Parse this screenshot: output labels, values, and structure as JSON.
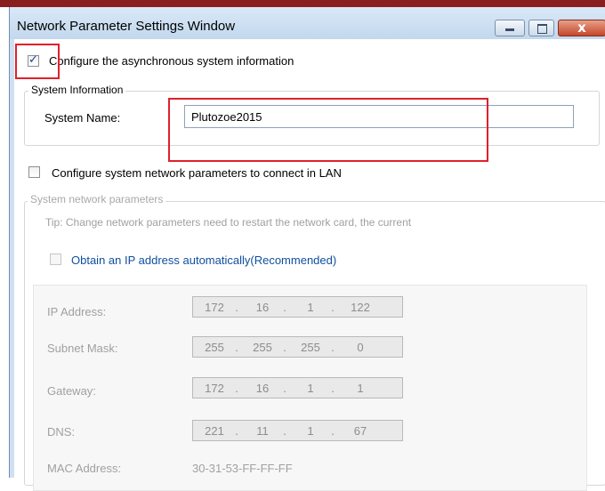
{
  "window": {
    "title": "Network Parameter Settings Window",
    "close_glyph": "x"
  },
  "async_config": {
    "checked": true,
    "label": "Configure the asynchronous system information"
  },
  "system_info": {
    "legend": "System Information",
    "name_label": "System Name:",
    "name_value": "Plutozoe2015"
  },
  "lan_config": {
    "checked": false,
    "label": "Configure system network parameters to connect in LAN"
  },
  "network_params": {
    "legend": "System network parameters",
    "tip": "Tip: Change network parameters need to restart the network card, the current",
    "auto_ip": {
      "checked": false,
      "label": "Obtain an IP address automatically(Recommended)"
    },
    "ip_address": {
      "label": "IP Address:",
      "octets": [
        "172",
        "16",
        "1",
        "122"
      ]
    },
    "subnet_mask": {
      "label": "Subnet Mask:",
      "octets": [
        "255",
        "255",
        "255",
        "0"
      ]
    },
    "gateway": {
      "label": "Gateway:",
      "octets": [
        "172",
        "16",
        "1",
        "1"
      ]
    },
    "dns": {
      "label": "DNS:",
      "octets": [
        "221",
        "11",
        "1",
        "67"
      ]
    },
    "mac": {
      "label": "MAC Address:",
      "value": "30-31-53-FF-FF-FF"
    },
    "dot": "."
  },
  "colors": {
    "annotation": "#e0202a",
    "title_bar": "#cfe0f2",
    "link_blue": "#0f4f9e",
    "disabled_text": "#a0a0a0"
  }
}
